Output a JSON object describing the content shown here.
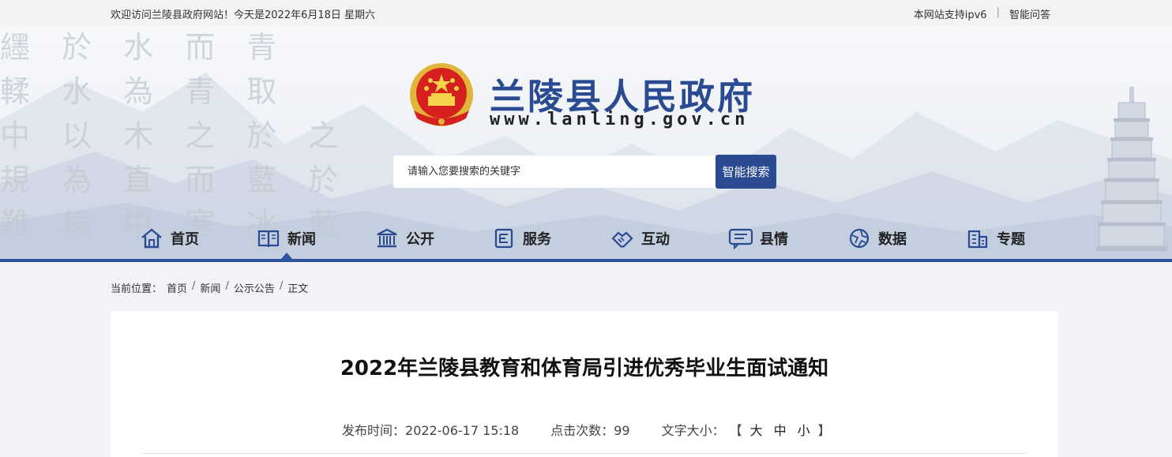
{
  "topbar": {
    "welcome": "欢迎访问兰陵县政府网站！今天是2022年6月18日  星期六",
    "ipv6": "本网站支持ipv6",
    "separator": "|",
    "qa": "智能问答"
  },
  "header": {
    "title": "兰陵县人民政府",
    "url": "www.lanling.gov.cn",
    "calligraphy": [
      "纆 於 水 而 青",
      "輮 水 為 青 取",
      "中 以 木 之 於 之",
      "規 為 直 而 藍 於",
      "難 輪 中 寒 冰 藍"
    ]
  },
  "search": {
    "placeholder": "请输入您要搜索的关键字",
    "button": "智能搜索"
  },
  "nav": {
    "items": [
      {
        "label": "首页",
        "icon": "home-icon"
      },
      {
        "label": "新闻",
        "icon": "book-icon"
      },
      {
        "label": "公开",
        "icon": "building-icon"
      },
      {
        "label": "服务",
        "icon": "service-icon"
      },
      {
        "label": "互动",
        "icon": "handshake-icon"
      },
      {
        "label": "县情",
        "icon": "chat-icon"
      },
      {
        "label": "数据",
        "icon": "globe-icon"
      },
      {
        "label": "专题",
        "icon": "city-icon"
      }
    ],
    "active_index": 1
  },
  "breadcrumb": {
    "label": "当前位置：",
    "items": [
      "首页",
      "新闻",
      "公示公告",
      "正文"
    ],
    "separator": "/"
  },
  "article": {
    "title": "2022年兰陵县教育和体育局引进优秀毕业生面试通知",
    "publish_label": "发布时间：",
    "publish_time": "2022-06-17 15:18",
    "clicks_label": "点击次数：",
    "clicks": "99",
    "fontsize_label": "文字大小：",
    "bracket_open": "【",
    "bracket_close": "】",
    "size_large": "大",
    "size_medium": "中",
    "size_small": "小"
  },
  "colors": {
    "brand": "#2a4a92",
    "accent_line": "#2f55a0",
    "background": "#f1f3f7"
  }
}
